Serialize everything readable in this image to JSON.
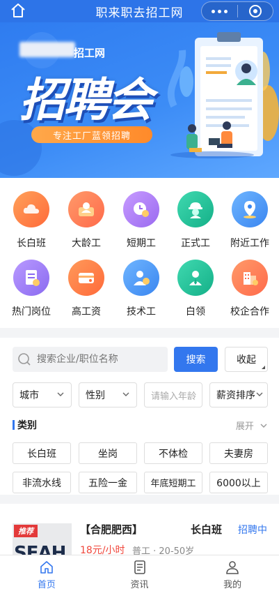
{
  "header": {
    "title": "职来职去招工网"
  },
  "banner": {
    "brand": "招工网",
    "headline": "招聘会",
    "slogan": "专注工厂蓝领招聘"
  },
  "categories": [
    {
      "label": "长白班",
      "icon": "cloud-icon"
    },
    {
      "label": "大龄工",
      "icon": "person-card-icon"
    },
    {
      "label": "短期工",
      "icon": "clock-icon"
    },
    {
      "label": "正式工",
      "icon": "worker-helmet-icon"
    },
    {
      "label": "附近工作",
      "icon": "location-pin-icon"
    },
    {
      "label": "热门岗位",
      "icon": "document-icon"
    },
    {
      "label": "高工资",
      "icon": "wallet-icon"
    },
    {
      "label": "技术工",
      "icon": "technician-icon"
    },
    {
      "label": "白领",
      "icon": "white-collar-icon"
    },
    {
      "label": "校企合作",
      "icon": "building-icon"
    }
  ],
  "search": {
    "placeholder": "搜索企业/职位名称",
    "button": "搜索",
    "collapse": "收起"
  },
  "filters": {
    "city": "城市",
    "gender": "性别",
    "age_placeholder": "请输入年龄",
    "sort": "薪资排序"
  },
  "type_section": {
    "title": "类别",
    "expand": "展开"
  },
  "tags": [
    "长白班",
    "坐岗",
    "不体检",
    "夫妻房",
    "非流水线",
    "五险一金",
    "年底短期工",
    "6000以上"
  ],
  "job": {
    "badge": "推荐",
    "logo_text": "SEAH",
    "title_prefix": "【合肥肥西】",
    "title_suffix": "长白班",
    "status": "招聘中",
    "salary": "18元/小时",
    "meta": "普工 · 20-50岁"
  },
  "tabs": [
    {
      "label": "首页",
      "icon": "home-icon"
    },
    {
      "label": "资讯",
      "icon": "news-icon"
    },
    {
      "label": "我的",
      "icon": "user-icon"
    }
  ],
  "colors": {
    "primary": "#3377ee",
    "salary": "#f0473c",
    "topbar": "#2d74e8"
  }
}
